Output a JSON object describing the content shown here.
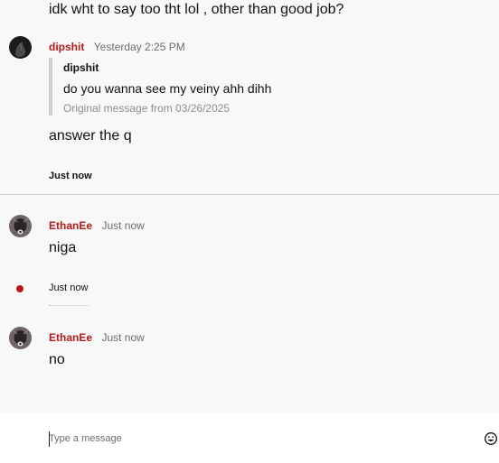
{
  "messages": [
    {
      "text": "idk wht to say too tht lol , other than good job?"
    },
    {
      "author": "dipshit",
      "timestamp": "Yesterday 2:25 PM",
      "quote": {
        "author": "dipshit",
        "text": "do you wanna see my veiny ahh dihh",
        "origin": "Original message from 03/26/2025"
      },
      "text": "answer the q",
      "status": "Just now"
    },
    {
      "author": "EthanEe",
      "timestamp": "Just now",
      "text": "niga",
      "status": "Just now"
    },
    {
      "author": "EthanEe",
      "timestamp": "Just now",
      "text": "no"
    }
  ],
  "composer": {
    "placeholder": "Type a message",
    "emoji_icon": "smiley-icon"
  },
  "colors": {
    "author": "#b51a1a",
    "background": "#f8f8f8",
    "composer_background": "#ffffff",
    "divider": "#d2d2d2"
  }
}
